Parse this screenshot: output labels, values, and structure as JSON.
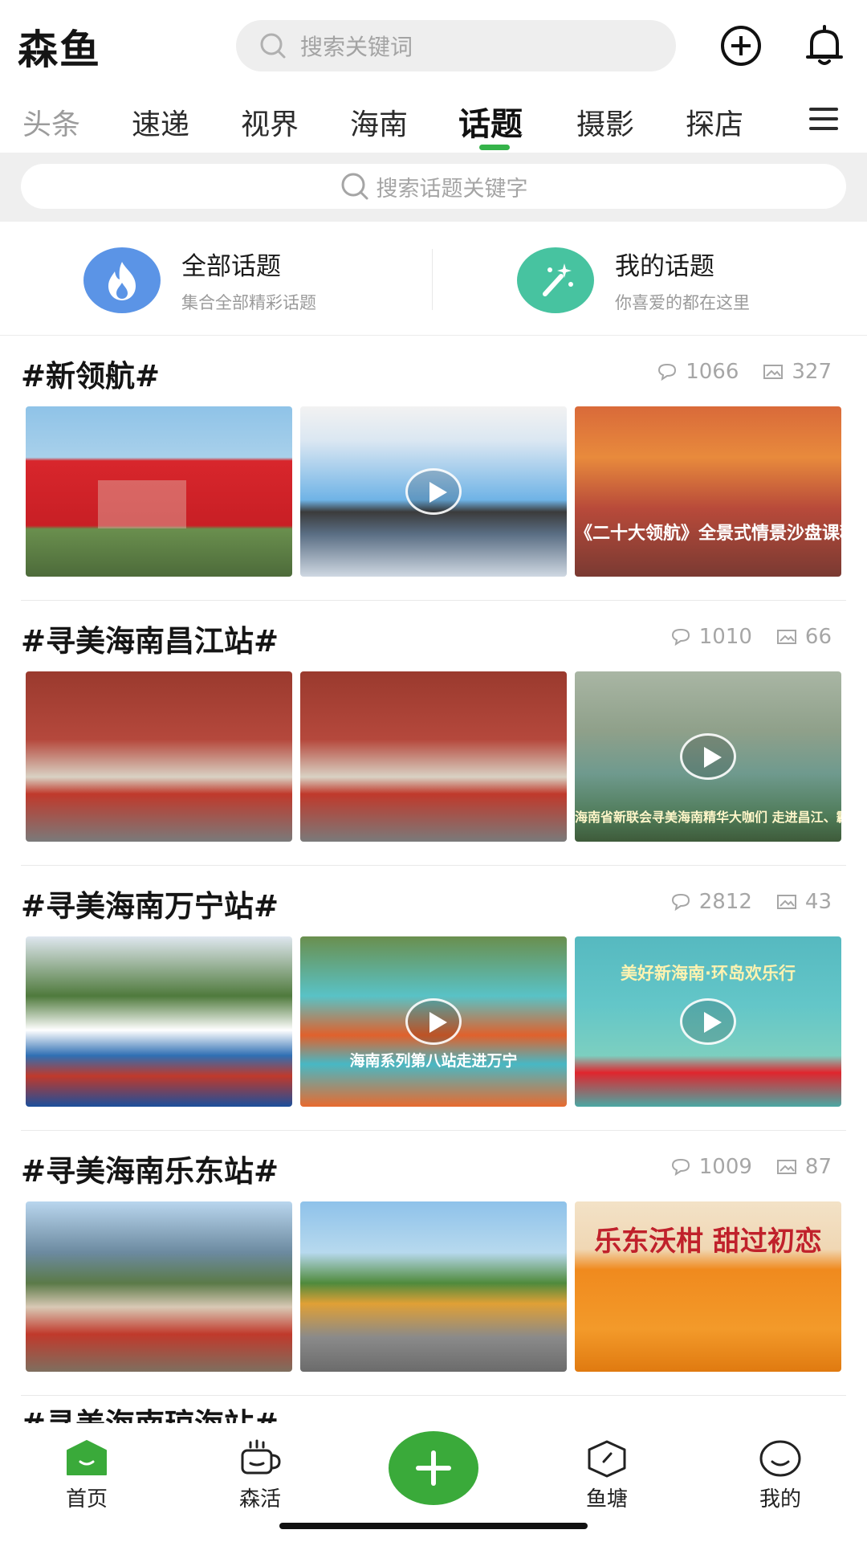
{
  "app": {
    "logo": "森鱼"
  },
  "search": {
    "placeholder": "搜索关键词"
  },
  "tabs": [
    {
      "label": "头条"
    },
    {
      "label": "速递"
    },
    {
      "label": "视界"
    },
    {
      "label": "海南"
    },
    {
      "label": "话题",
      "active": true
    },
    {
      "label": "摄影"
    },
    {
      "label": "探店"
    }
  ],
  "topic_search": {
    "placeholder": "搜索话题关键字"
  },
  "categories": [
    {
      "title": "全部话题",
      "subtitle": "集合全部精彩话题",
      "icon": "flame-icon",
      "color": "#5b94e6"
    },
    {
      "title": "我的话题",
      "subtitle": "你喜爱的都在这里",
      "icon": "magic-wand-icon",
      "color": "#47c3a0"
    }
  ],
  "topics": [
    {
      "title": "#新领航#",
      "comments": "1066",
      "images": "327",
      "thumbs": [
        {
          "caption": "",
          "video": false
        },
        {
          "caption": "",
          "video": true
        },
        {
          "caption": "《二十大领航》全景式情景沙盘课程环节掠影",
          "video": false
        }
      ]
    },
    {
      "title": "#寻美海南昌江站#",
      "comments": "1010",
      "images": "66",
      "thumbs": [
        {
          "caption": "",
          "video": false
        },
        {
          "caption": "",
          "video": false
        },
        {
          "caption": "海南省新联会寻美海南精华大咖们 走进昌江、霸王岭、七叉镇、乙洞村",
          "video": true
        }
      ]
    },
    {
      "title": "#寻美海南万宁站#",
      "comments": "2812",
      "images": "43",
      "thumbs": [
        {
          "caption": "",
          "video": false
        },
        {
          "caption": "海南系列第八站走进万宁",
          "video": true
        },
        {
          "caption": "美好新海南·环岛欢乐行",
          "video": true
        }
      ]
    },
    {
      "title": "#寻美海南乐东站#",
      "comments": "1009",
      "images": "87",
      "thumbs": [
        {
          "caption": "",
          "video": false
        },
        {
          "caption": "",
          "video": false
        },
        {
          "caption": "乐东沃柑 甜过初恋",
          "video": false
        }
      ]
    }
  ],
  "peek_title": "#寻美海南琼海站#",
  "bottom_nav": [
    {
      "label": "首页"
    },
    {
      "label": "森活"
    },
    {
      "label": "鱼塘"
    },
    {
      "label": "我的"
    }
  ],
  "colors": {
    "accent": "#35b34a",
    "fab": "#3aaa3a"
  }
}
